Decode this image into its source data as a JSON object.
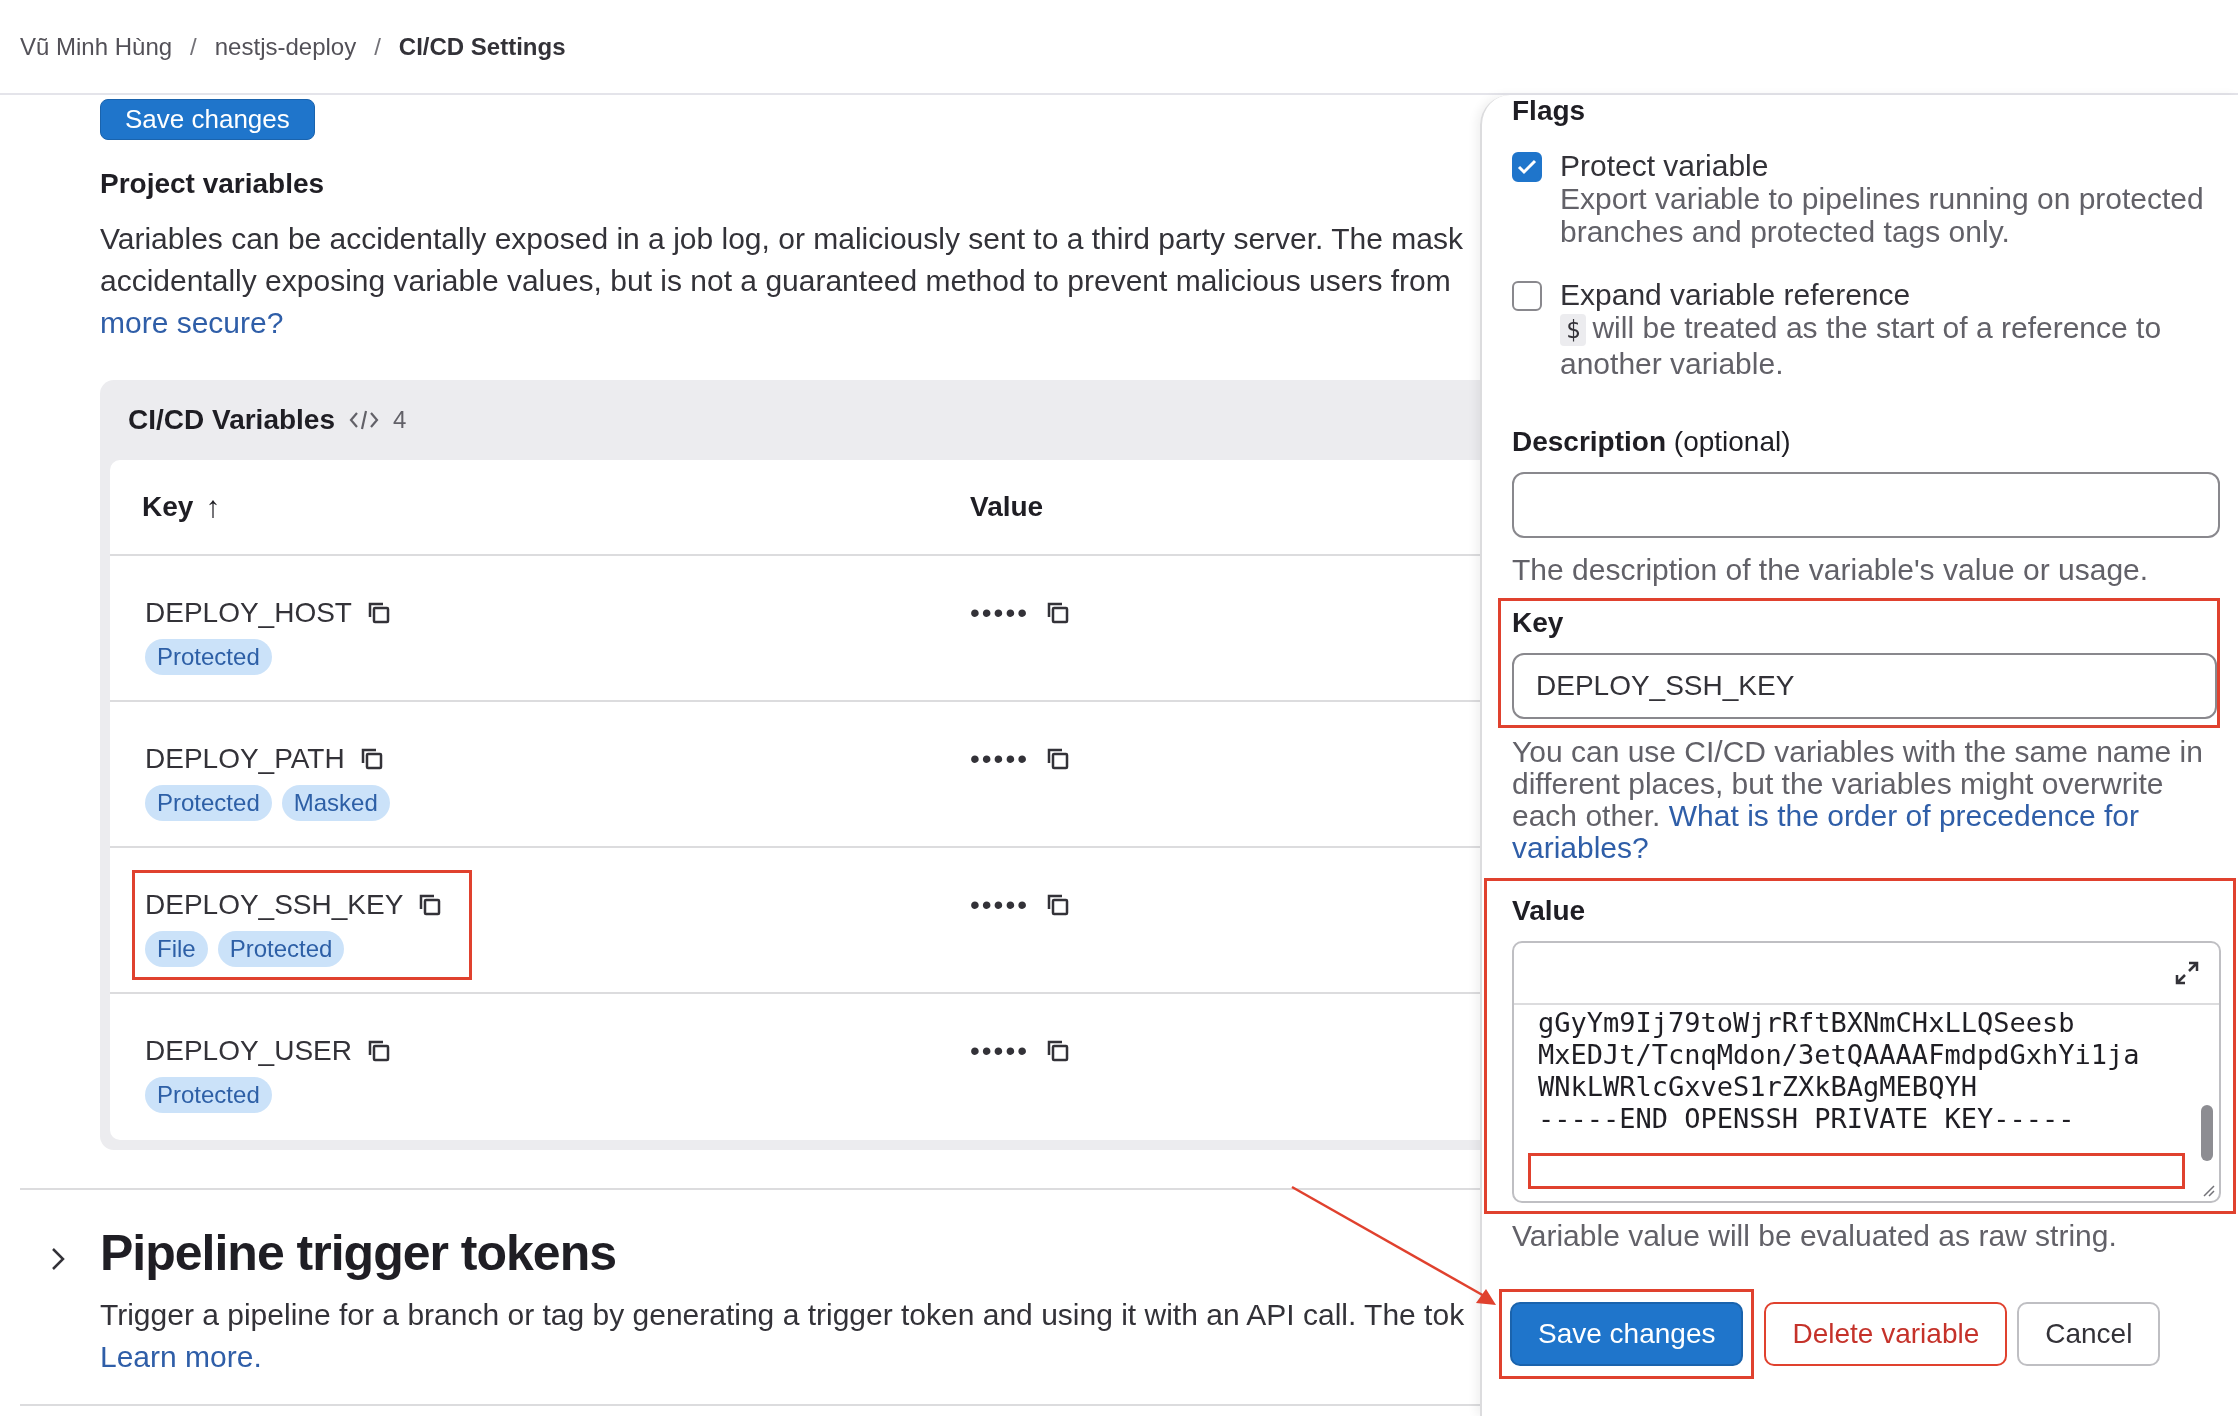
{
  "breadcrumb_separator": "/",
  "breadcrumb": [
    {
      "label": "Vũ Minh Hùng",
      "current": false
    },
    {
      "label": "nestjs-deploy",
      "current": false
    },
    {
      "label": "CI/CD Settings",
      "current": true
    }
  ],
  "top_button": {
    "label": "Save changes"
  },
  "project_variables": {
    "title": "Project variables",
    "description_lines": [
      "Variables can be accidentally exposed in a job log, or maliciously sent to a third party server. The mask",
      "accidentally exposing variable values, but is not a guaranteed method to prevent malicious users from"
    ],
    "link": "more secure?"
  },
  "variables_card": {
    "title": "CI/CD Variables",
    "count": "4",
    "columns": [
      {
        "label": "Key",
        "sort_indicator": "↑"
      },
      {
        "label": "Value"
      }
    ],
    "rows": [
      {
        "key": "DEPLOY_HOST",
        "value": "•••••",
        "badges": [
          "Protected"
        ],
        "highlighted": false
      },
      {
        "key": "DEPLOY_PATH",
        "value": "•••••",
        "badges": [
          "Protected",
          "Masked"
        ],
        "highlighted": false
      },
      {
        "key": "DEPLOY_SSH_KEY",
        "value": "•••••",
        "badges": [
          "File",
          "Protected"
        ],
        "highlighted": true
      },
      {
        "key": "DEPLOY_USER",
        "value": "•••••",
        "badges": [
          "Protected"
        ],
        "highlighted": false
      }
    ]
  },
  "pipeline_triggers": {
    "title": "Pipeline trigger tokens",
    "expanded": false,
    "description": "Trigger a pipeline for a branch or tag by generating a trigger token and using it with an API call. The tok",
    "link": "Learn more."
  },
  "drawer": {
    "flags_title": "Flags",
    "flags": [
      {
        "label": "Protect variable",
        "checked": true,
        "help": "Export variable to pipelines running on protected branches and protected tags only."
      },
      {
        "label": "Expand variable reference",
        "checked": false,
        "help_code": "$",
        "help": "will be treated as the start of a reference to another variable."
      }
    ],
    "description": {
      "label": "Description",
      "optional": "(optional)",
      "help": "The description of the variable's value or usage."
    },
    "key": {
      "label": "Key",
      "value": "DEPLOY_SSH_KEY",
      "help": "You can use CI/CD variables with the same name in different places, but the variables might overwrite each other.",
      "link_lines": [
        "What is the order of precedence for",
        "variables?"
      ],
      "highlighted": true
    },
    "value": {
      "label": "Value",
      "lines": [
        "gGyYm9Ij79toWjrRftBXNmCHxLLQSeesb",
        "MxEDJt/TcnqMdon/3etQAAAAFmdpdGxhYi1ja",
        "WNkLWRlcGxveS1rZXkBAgMEBQYH",
        "-----END OPENSSH PRIVATE KEY-----"
      ],
      "help": "Variable value will be evaluated as raw string.",
      "highlighted": true,
      "empty_line_highlighted": true
    },
    "buttons": [
      {
        "label": "Save changes",
        "kind": "primary",
        "highlighted": true
      },
      {
        "label": "Delete variable",
        "kind": "danger",
        "highlighted": false
      },
      {
        "label": "Cancel",
        "kind": "default",
        "highlighted": false
      }
    ]
  }
}
